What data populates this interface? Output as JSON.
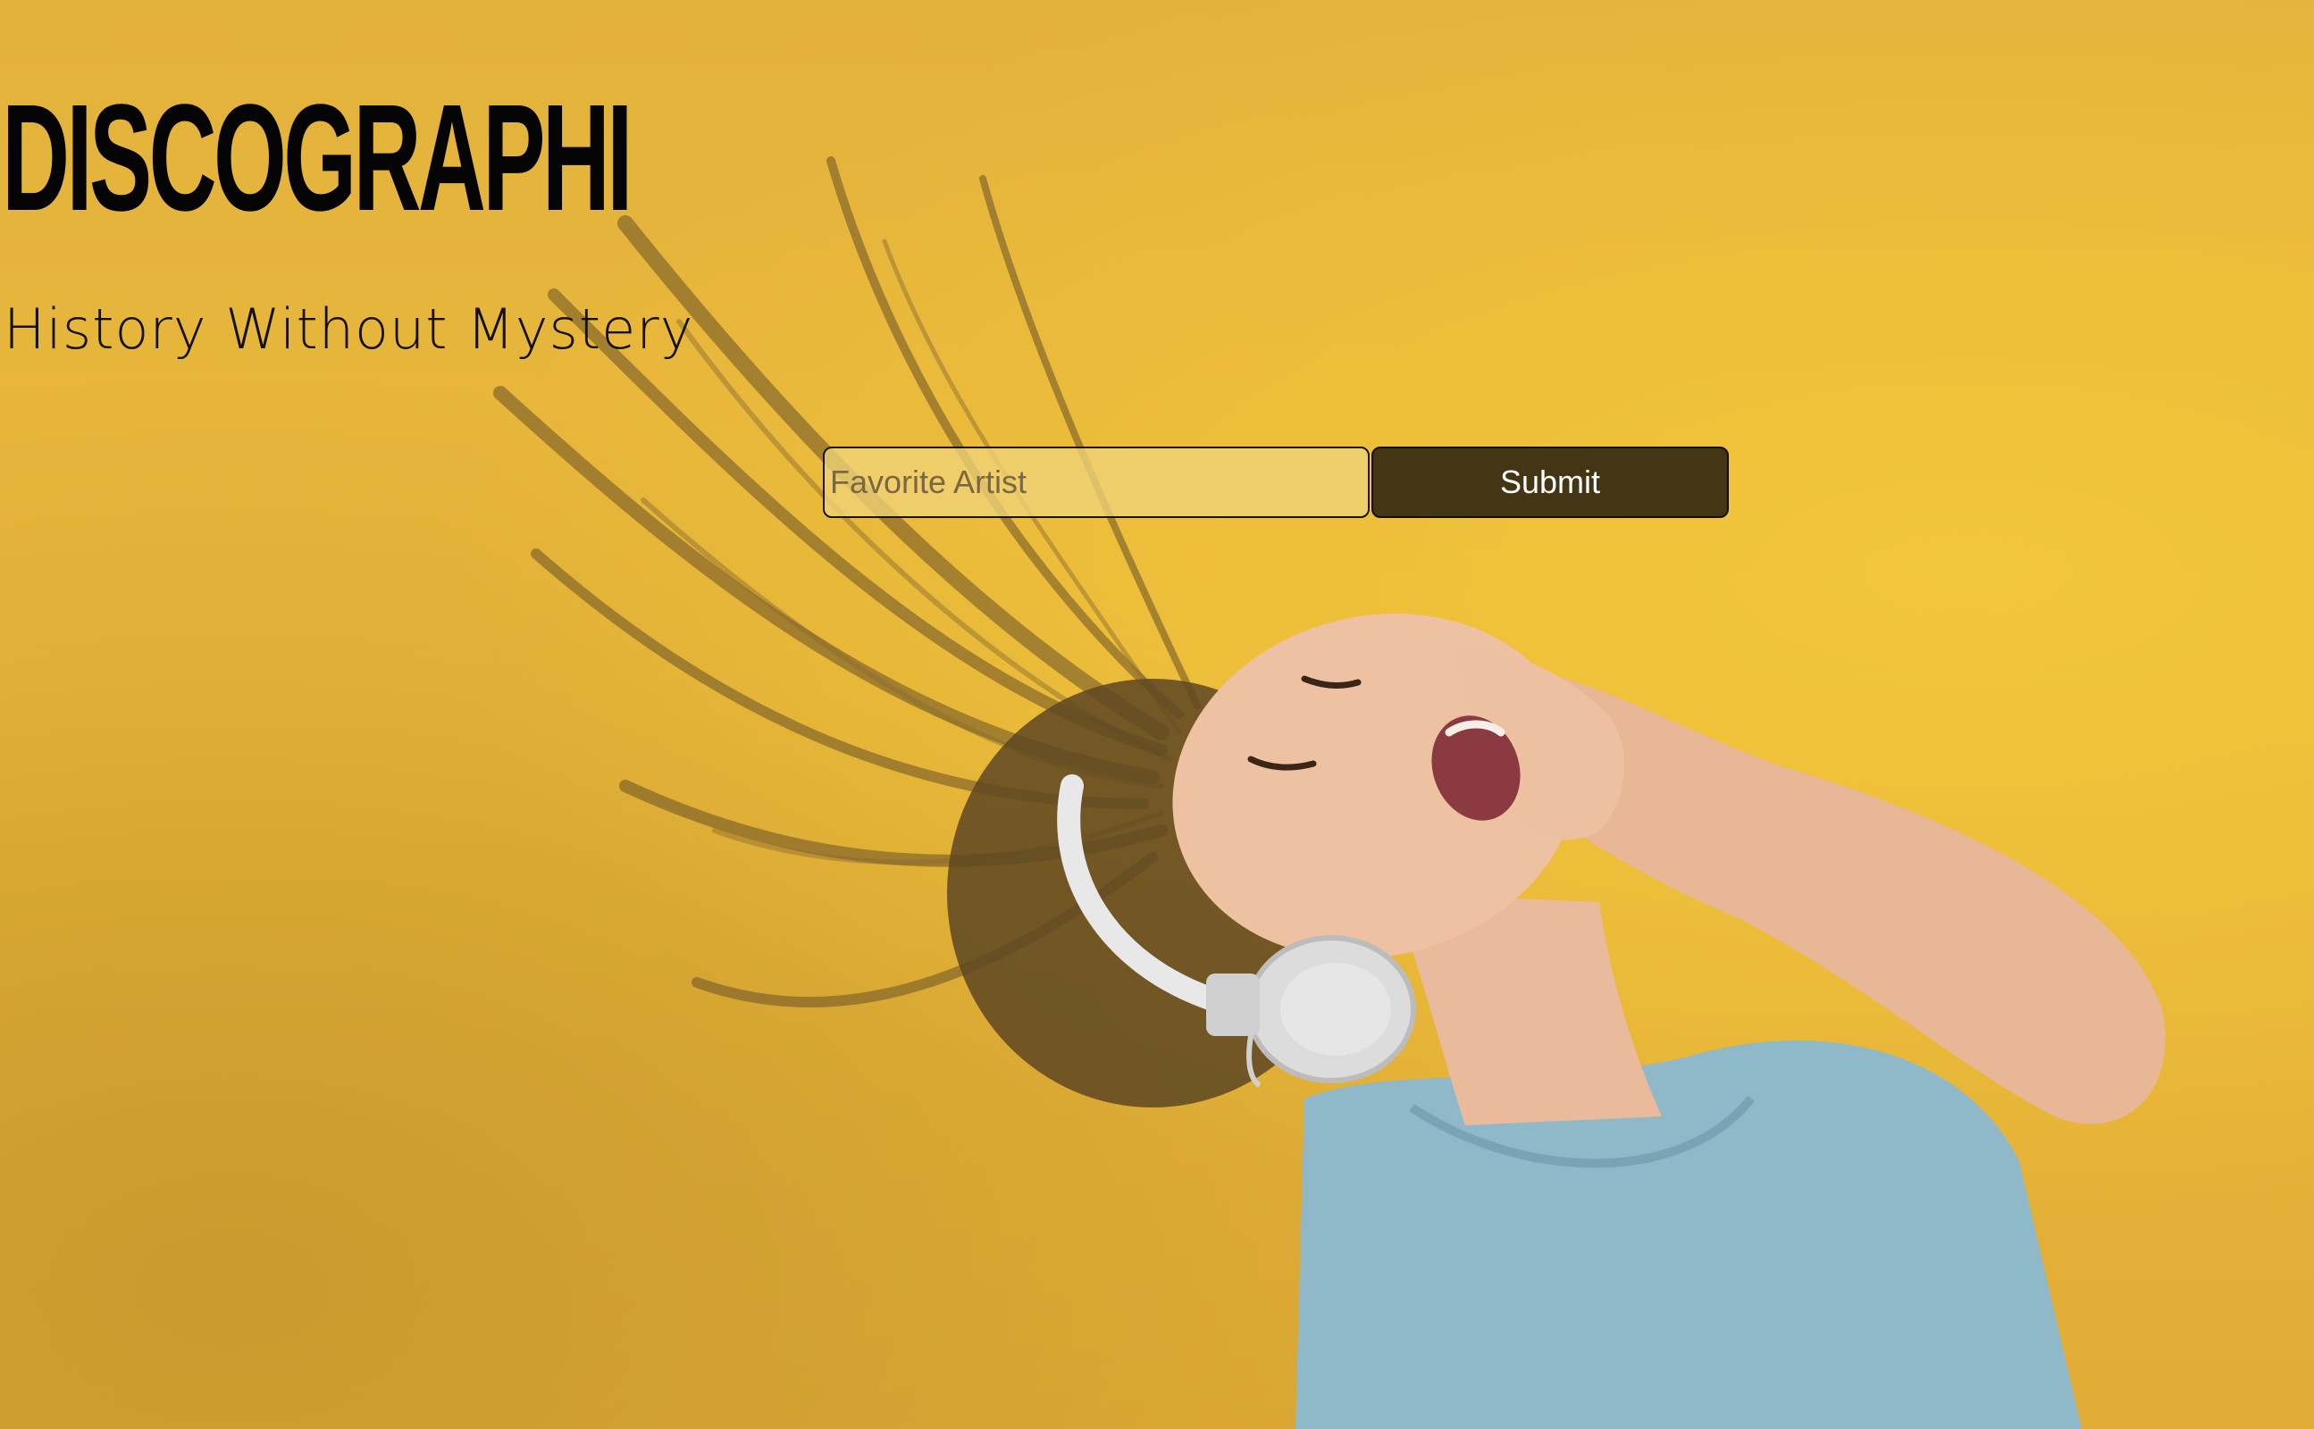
{
  "header": {
    "title": "DISCOGRAPHI",
    "tagline": "History Without Mystery"
  },
  "search": {
    "placeholder": "Favorite Artist",
    "value": "",
    "submit_label": "Submit"
  },
  "hero": {
    "image_name": "woman-with-headphones-photo"
  },
  "colors": {
    "background": "#e8b43a",
    "button": "#443514",
    "button_text": "#ffffff",
    "title": "#050505"
  }
}
